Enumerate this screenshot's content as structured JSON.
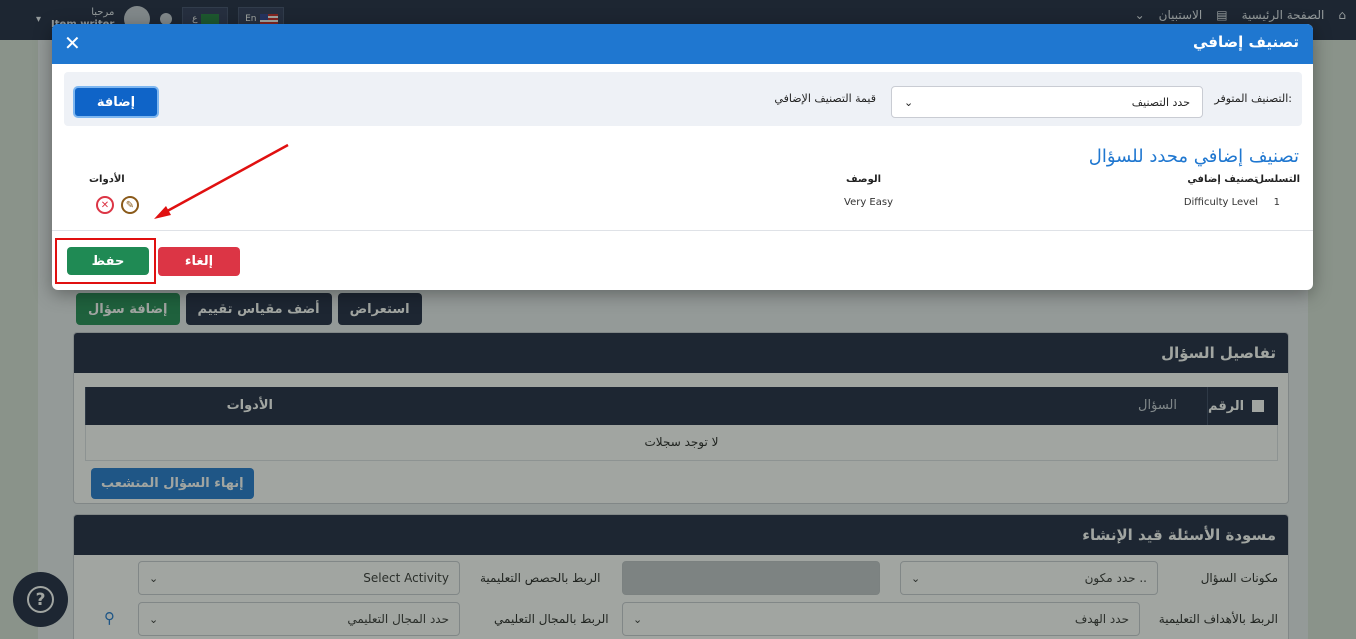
{
  "topbar": {
    "home_label": "الصفحة الرئيسية",
    "surveys_label": "الاستبيان",
    "greeting": "مرحبا",
    "username": "Item writer",
    "lang_en": "En",
    "lang_ar": "ع"
  },
  "actions": {
    "add_question": "إضافة سؤال",
    "add_rubric": "أضف مقياس تقييم",
    "preview": "استعراض"
  },
  "question_details": {
    "title": "تفاصيل السؤال",
    "col_number": "الرقم",
    "col_question": "السؤال",
    "col_tools": "الأدوات",
    "empty_text": "لا توجد سجلات",
    "end_branch_button": "إنهاء السؤال المتشعب"
  },
  "drafts": {
    "title": "مسودة الأسئلة قيد الإنشاء",
    "components_label": "مكونات السؤال",
    "components_value": "حدد مكون ..",
    "lessons_label": "الربط بالحصص التعليمية",
    "lessons_value": "Select Activity",
    "objectives_label": "الربط بالأهداف التعليمية",
    "objectives_value": "حدد الهدف",
    "domain_label": "الربط بالمجال التعليمي",
    "domain_value": "حدد المجال التعليمي"
  },
  "modal": {
    "title": "تصنيف إضافي",
    "available_label": "التصنيف المتوفر:",
    "classification_placeholder": "حدد التصنيف",
    "value_label": "قيمة التصنيف الإضافي",
    "add_button": "إضافة",
    "section_title": "تصنيف إضافي محدد للسؤال",
    "table": {
      "col_seq": "التسلسل",
      "col_class": "تصنيف إضافي",
      "col_desc": "الوصف",
      "col_tools": "الأدوات",
      "row": {
        "seq": "1",
        "classification": "Difficulty Level",
        "description": "Very Easy"
      }
    },
    "save_button": "حفظ",
    "cancel_button": "إلغاء"
  },
  "colors": {
    "primary": "#1f77d0",
    "navy": "#1c2540",
    "save_green": "#1f8a54",
    "cancel_red": "#dc3545",
    "annotation_red": "#e01010"
  },
  "icons": [
    "home-icon",
    "survey-icon",
    "chevron-down-icon",
    "close-icon",
    "edit-icon",
    "delete-icon",
    "search-icon",
    "help-icon",
    "user-avatar"
  ]
}
